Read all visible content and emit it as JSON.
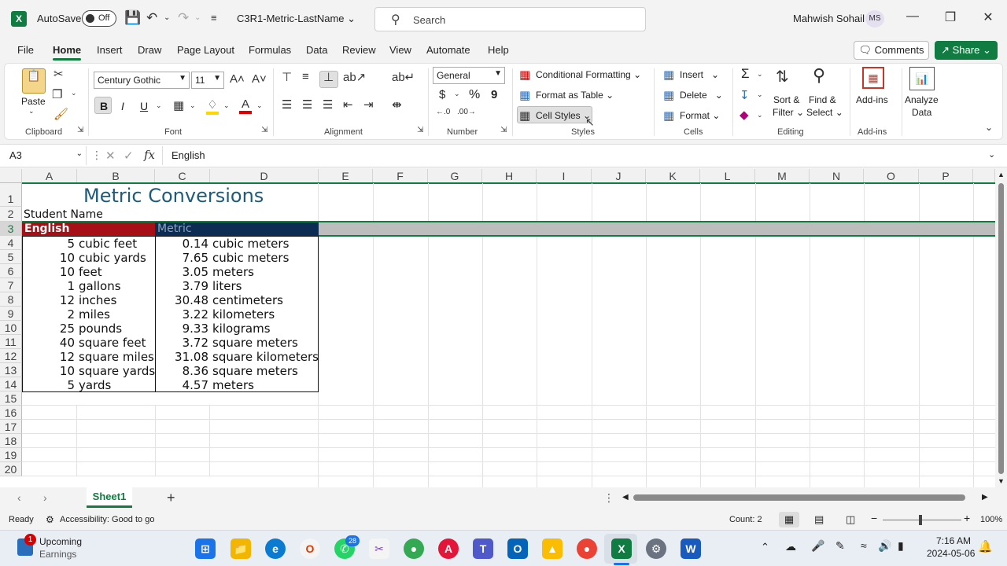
{
  "titlebar": {
    "app_logo": "X",
    "autosave_label": "AutoSave",
    "autosave_state": "Off",
    "filename": "C3R1-Metric-LastName",
    "search_placeholder": "Search",
    "user_name": "Mahwish Sohail",
    "user_initials": "MS"
  },
  "menu": {
    "tabs": [
      "File",
      "Home",
      "Insert",
      "Draw",
      "Page Layout",
      "Formulas",
      "Data",
      "Review",
      "View",
      "Automate",
      "Help"
    ],
    "active": "Home",
    "comments": "Comments",
    "share": "Share"
  },
  "ribbon": {
    "clipboard": {
      "paste": "Paste",
      "label": "Clipboard"
    },
    "font": {
      "name": "Century Gothic",
      "size": "11",
      "bold": "B",
      "italic": "I",
      "underline": "U",
      "label": "Font"
    },
    "alignment": {
      "label": "Alignment"
    },
    "number": {
      "format": "General",
      "currency": "$",
      "percent": "%",
      "comma": "9",
      "label": "Number"
    },
    "styles": {
      "conditional": "Conditional Formatting",
      "format_table": "Format as Table",
      "cell_styles": "Cell Styles",
      "label": "Styles"
    },
    "cells": {
      "insert": "Insert",
      "delete": "Delete",
      "format": "Format",
      "label": "Cells"
    },
    "editing": {
      "autosum": "Σ",
      "sort_filter_1": "Sort &",
      "sort_filter_2": "Filter",
      "find_select_1": "Find &",
      "find_select_2": "Select",
      "label": "Editing"
    },
    "addins": {
      "addins": "Add-ins",
      "label": "Add-ins"
    },
    "analyze": {
      "line1": "Analyze",
      "line2": "Data"
    }
  },
  "formula_bar": {
    "name_box": "A3",
    "fx": "fx",
    "value": "English"
  },
  "sheet": {
    "columns": [
      "A",
      "B",
      "C",
      "D",
      "E",
      "F",
      "G",
      "H",
      "I",
      "J",
      "K",
      "L",
      "M",
      "N",
      "O",
      "P"
    ],
    "rows": [
      "1",
      "2",
      "3",
      "4",
      "5",
      "6",
      "7",
      "8",
      "9",
      "10",
      "11",
      "12",
      "13",
      "14",
      "15",
      "16",
      "17",
      "18",
      "19",
      "20"
    ],
    "title": "Metric Conversions",
    "student": "Student Name",
    "header_english": "English",
    "header_metric": "Metric",
    "data": [
      [
        "5",
        "cubic feet",
        "0.14",
        "cubic meters"
      ],
      [
        "10",
        "cubic yards",
        "7.65",
        "cubic meters"
      ],
      [
        "10",
        "feet",
        "3.05",
        "meters"
      ],
      [
        "1",
        "gallons",
        "3.79",
        "liters"
      ],
      [
        "12",
        "inches",
        "30.48",
        "centimeters"
      ],
      [
        "2",
        "miles",
        "3.22",
        "kilometers"
      ],
      [
        "25",
        "pounds",
        "9.33",
        "kilograms"
      ],
      [
        "40",
        "square feet",
        "3.72",
        "square meters"
      ],
      [
        "12",
        "square miles",
        "31.08",
        "square kilometers"
      ],
      [
        "10",
        "square yards",
        "8.36",
        "square meters"
      ],
      [
        "5",
        "yards",
        "4.57",
        "meters"
      ]
    ],
    "colors": {
      "english_fill": "#a50f15",
      "metric_fill": "#0d2c54",
      "metric_text": "#8ea3bf",
      "title_color": "#1f5a7a"
    }
  },
  "sheet_tabs": {
    "active": "Sheet1",
    "add": "+"
  },
  "status": {
    "ready": "Ready",
    "accessibility": "Accessibility: Good to go",
    "count": "Count: 2",
    "zoom": "100%"
  },
  "taskbar": {
    "widget_title": "Upcoming",
    "widget_sub": "Earnings",
    "widget_badge": "1",
    "whatsapp_badge": "28",
    "time": "7:16 AM",
    "date": "2024-05-06"
  }
}
